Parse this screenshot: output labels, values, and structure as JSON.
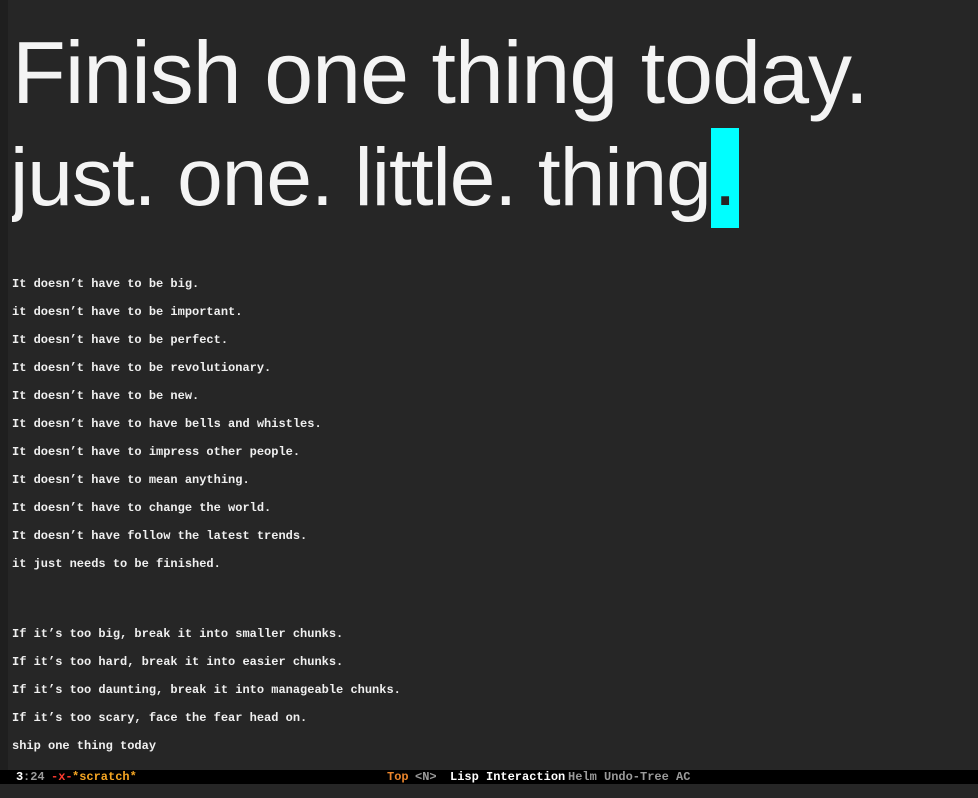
{
  "buffer": {
    "heading_line_1": "Finish one thing today.",
    "heading_line_2_text": "just. one. little. thing",
    "heading_line_2_cursor_char": ".",
    "lines_group_1": [
      "It doesn’t have to be big.",
      "it doesn’t have to be important.",
      "It doesn’t have to be perfect.",
      "It doesn’t have to be revolutionary.",
      "It doesn’t have to be new.",
      "It doesn’t have to have bells and whistles.",
      "It doesn’t have to impress other people.",
      "It doesn’t have to mean anything.",
      "It doesn’t have to change the world.",
      "It doesn’t have follow the latest trends.",
      "it just needs to be finished."
    ],
    "lines_group_2": [
      "If it’s too big, break it into smaller chunks.",
      "If it’s too hard, break it into easier chunks.",
      "If it’s too daunting, break it into manageable chunks.",
      "If it’s too scary, face the fear head on.",
      "ship one thing today"
    ]
  },
  "modeline": {
    "line": "3",
    "column": ":24",
    "modified_marker": "-x-",
    "buffer_name": "*scratch*",
    "position": "Top",
    "evil_state": "<N>",
    "major_mode": "Lisp Interaction",
    "minor_modes": "Helm Undo-Tree AC"
  },
  "colors": {
    "background": "#262626",
    "text": "#f0f0f0",
    "cursor": "#00ffff",
    "modeline_bg": "#000000",
    "modified_marker": "#ff3b30",
    "buffer_name": "#f5a623",
    "position": "#e8842c",
    "dim": "#9a9a9a"
  }
}
